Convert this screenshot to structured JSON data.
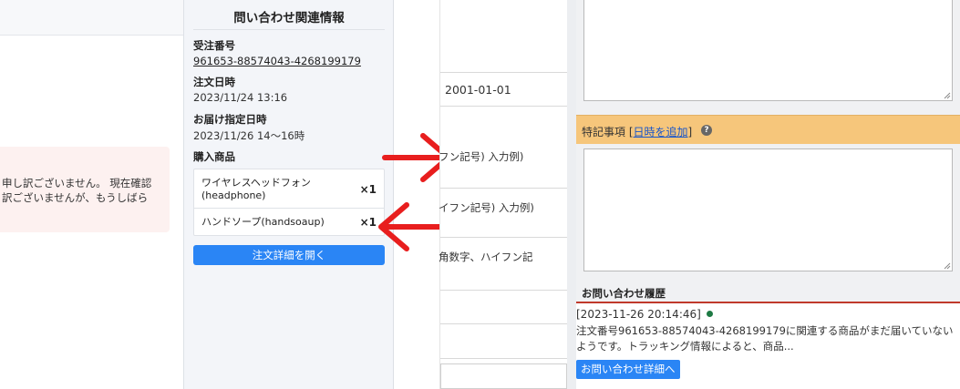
{
  "sidebar": {
    "title": "問い合わせ関連情報",
    "order_number_label": "受注番号",
    "order_number": "961653-88574043-4268199179",
    "order_date_label": "注文日時",
    "order_date": "2023/11/24 13:16",
    "delivery_label": "お届け指定日時",
    "delivery": "2023/11/26 14〜16時",
    "products_label": "購入商品",
    "products": [
      {
        "name_line1": "ワイヤレスヘッドフォン",
        "name_line2": "(headphone)",
        "qty": "×1"
      },
      {
        "name_line1": "ハンドソープ(handsoaup)",
        "name_line2": "",
        "qty": "×1"
      }
    ],
    "open_detail_label": "注文詳細を開く"
  },
  "alert": {
    "line1": "申し訳ございません。 現在確認",
    "line2": "訳ございませんが、もうしばら"
  },
  "form": {
    "date_value": "2001-01-01",
    "hint1": "フン記号) 入力例)",
    "hint2": "イフン記号) 入力例)",
    "hint3": "角数字、ハイフン記"
  },
  "notes": {
    "special_label": "特記事項",
    "add_datetime_link": "日時を追加",
    "help_glyph": "?"
  },
  "history": {
    "title": "お問い合わせ履歴",
    "timestamp": "[2023-11-26 20:14:46]",
    "body": "注文番号961653-88574043-4268199179に関連する商品がまだ届いていないようです。トラッキング情報によると、商品...",
    "button_label": "お問い合わせ詳細へ"
  },
  "colors": {
    "accent_blue": "#2a85f5",
    "arrow_red": "#e81e1e",
    "special_header_bg": "#f6c67b",
    "history_rule": "#c0392b",
    "status_dot": "#1e7a44"
  }
}
